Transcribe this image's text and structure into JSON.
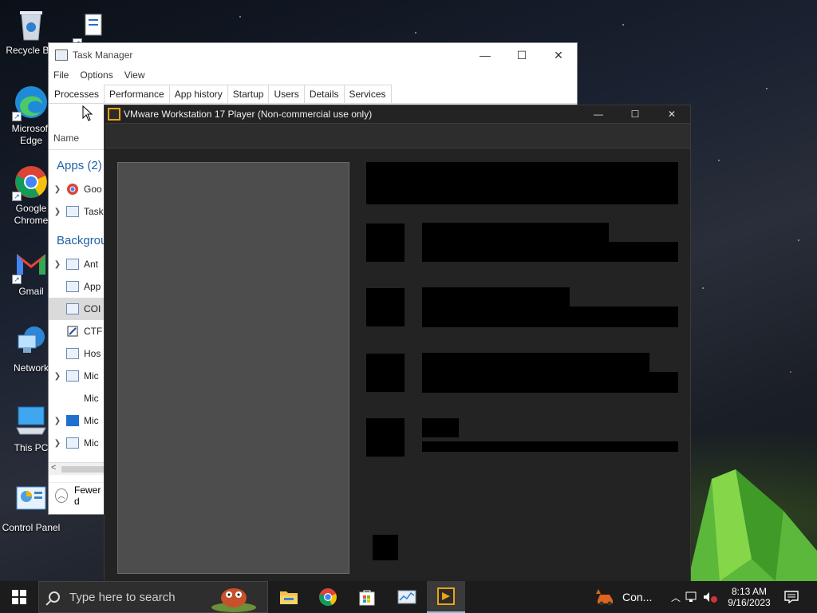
{
  "desktop": {
    "icons": [
      {
        "label": "Recycle Bin",
        "icon": "recycle-bin-icon"
      },
      {
        "label": "Microsoft Edge",
        "icon": "edge-icon"
      },
      {
        "label": "Google Chrome",
        "icon": "chrome-icon"
      },
      {
        "label": "Gmail",
        "icon": "gmail-icon"
      },
      {
        "label": "Network",
        "icon": "network-icon"
      },
      {
        "label": "This PC",
        "icon": "this-pc-icon"
      },
      {
        "label": "Control Panel",
        "icon": "control-panel-icon"
      }
    ]
  },
  "task_manager": {
    "title": "Task Manager",
    "menu": [
      "File",
      "Options",
      "View"
    ],
    "tabs": [
      "Processes",
      "Performance",
      "App history",
      "Startup",
      "Users",
      "Details",
      "Services"
    ],
    "active_tab": "Processes",
    "column_name": "Name",
    "groups": {
      "apps": "Apps (2)",
      "background": "Backgrou"
    },
    "rows": [
      {
        "text": "Goo",
        "expand": true
      },
      {
        "text": "Task",
        "expand": true
      },
      {
        "text": "Ant",
        "expand": true
      },
      {
        "text": "App",
        "expand": false
      },
      {
        "text": "COI",
        "expand": false,
        "selected": true
      },
      {
        "text": "CTF",
        "expand": false
      },
      {
        "text": "Hos",
        "expand": false
      },
      {
        "text": "Mic",
        "expand": true
      },
      {
        "text": "Mic",
        "expand": false
      },
      {
        "text": "Mic",
        "expand": true
      },
      {
        "text": "Mic",
        "expand": true
      }
    ],
    "footer": "Fewer d"
  },
  "vmware": {
    "title": "VMware Workstation 17 Player (Non-commercial use only)"
  },
  "taskbar": {
    "search_placeholder": "Type here to search",
    "tray_app_label": "Con...",
    "time": "8:13 AM",
    "date": "9/16/2023"
  },
  "colors": {
    "accent_group": "#1f5fa8",
    "vmware_orange": "#e8a317",
    "taskbar_bg": "#1c1c1c"
  }
}
